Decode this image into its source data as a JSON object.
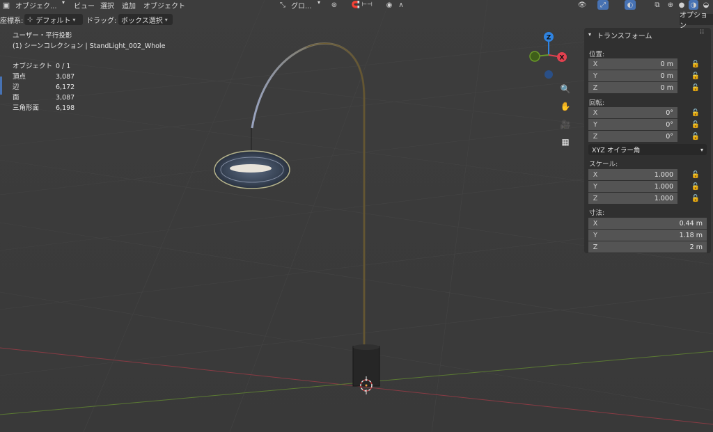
{
  "header": {
    "mode_label": "オブジェク...",
    "menus": [
      "ビュー",
      "選択",
      "追加",
      "オブジェクト"
    ],
    "transform_orientation": "グロ...",
    "coord_system_label": "座標系:",
    "coord_system_value": "デフォルト",
    "drag_label": "ドラッグ:",
    "drag_value": "ボックス選択",
    "options_tab": "オプション"
  },
  "overlay": {
    "view_name": "ユーザー・平行投影",
    "collection_line": "(1) シーンコレクション | StandLight_002_Whole",
    "stats": [
      {
        "label": "オブジェクト",
        "value": "0 / 1"
      },
      {
        "label": "頂点",
        "value": "3,087"
      },
      {
        "label": "辺",
        "value": "6,172"
      },
      {
        "label": "面",
        "value": "3,087"
      },
      {
        "label": "三角形面",
        "value": "6,198"
      }
    ]
  },
  "gizmo": {
    "z": "Z",
    "x": "X",
    "color_x": "#e2414f",
    "color_y": "#6a9a28",
    "color_z": "#2f83e0"
  },
  "npanel": {
    "title": "トランスフォーム",
    "location": {
      "label": "位置:",
      "x": "0 m",
      "y": "0 m",
      "z": "0 m"
    },
    "rotation": {
      "label": "回転:",
      "x": "0°",
      "y": "0°",
      "z": "0°",
      "mode": "XYZ オイラー角"
    },
    "scale": {
      "label": "スケール:",
      "x": "1.000",
      "y": "1.000",
      "z": "1.000"
    },
    "dimensions": {
      "label": "寸法:",
      "x": "0.44 m",
      "y": "1.18 m",
      "z": "2 m"
    },
    "axis_x": "X",
    "axis_y": "Y",
    "axis_z": "Z"
  },
  "colors": {
    "accent": "#4772b3",
    "background": "#3c3c3c",
    "panel": "#303030"
  }
}
